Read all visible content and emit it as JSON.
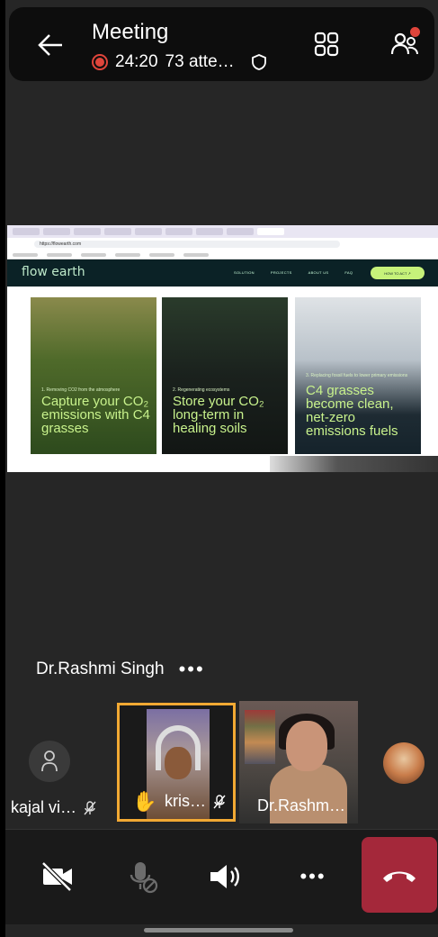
{
  "header": {
    "title": "Meeting",
    "duration": "24:20",
    "attendees": "73 atte…"
  },
  "shared_screen": {
    "url": "https://flowearth.com",
    "logo": "flow earth",
    "nav": [
      "SOLUTION",
      "PROJECTS",
      "ABOUT US",
      "FAQ"
    ],
    "cta": "HOW TO ACT ↗",
    "cards": [
      {
        "tag": "1. Removing CO2 from the atmosphere",
        "title": "Capture your CO₂ emissions with C4 grasses"
      },
      {
        "tag": "2. Regenerating ecosystems",
        "title": "Store your CO₂ long-term in healing soils"
      },
      {
        "tag": "3. Replacing fossil fuels to lower primary emissions",
        "title": "C4 grasses become clean, net-zero emissions fuels"
      }
    ]
  },
  "speaker": {
    "name": "Dr.Rashmi Singh",
    "more": "•••"
  },
  "participants": [
    {
      "name": "kajal vi…"
    },
    {
      "name": "kris…"
    },
    {
      "name": "Dr.Rashm…"
    }
  ],
  "controls": {
    "more": "•••"
  },
  "colors": {
    "accent_border": "#f2a933",
    "end_call": "#a4283a",
    "recording": "#e0453b"
  }
}
